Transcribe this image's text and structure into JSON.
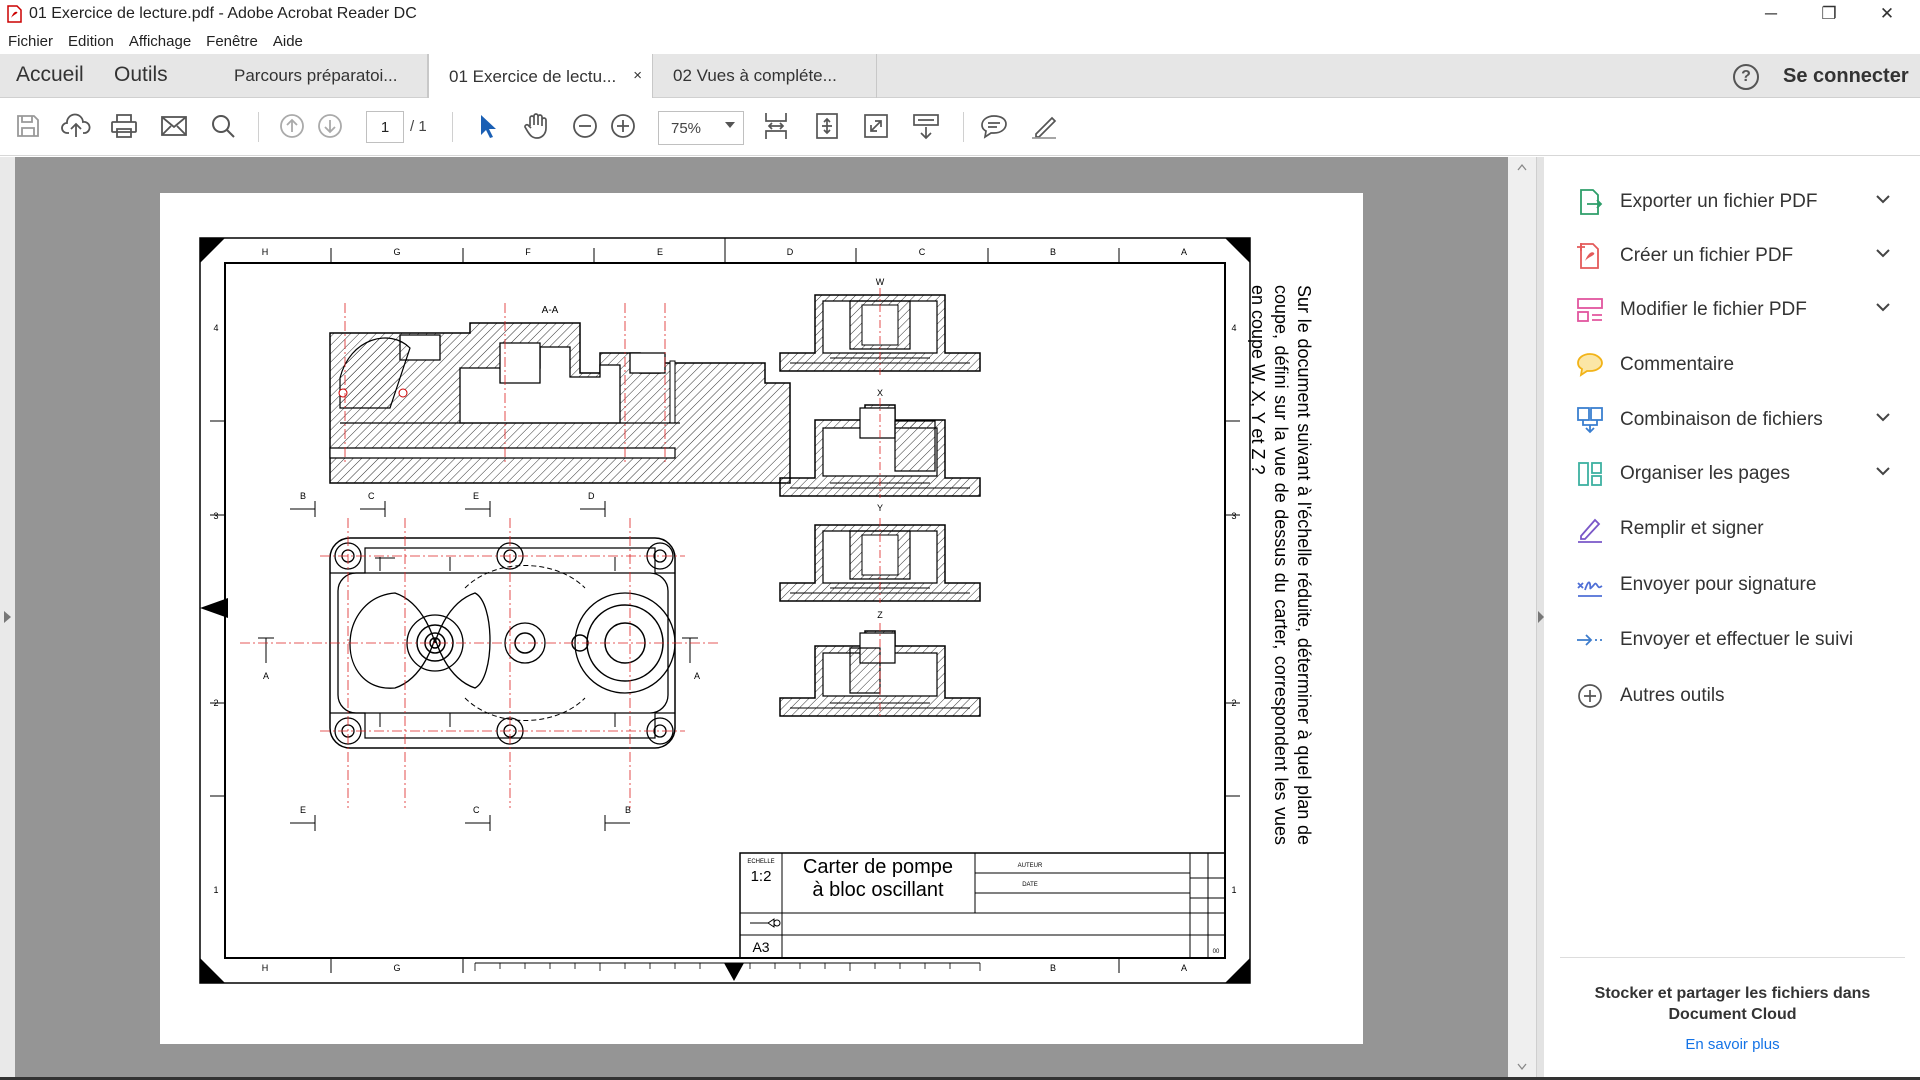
{
  "window": {
    "title": "01 Exercice de lecture.pdf - Adobe Acrobat Reader DC",
    "minimize": "─",
    "maximize": "❐",
    "close": "✕"
  },
  "menu": [
    "Fichier",
    "Edition",
    "Affichage",
    "Fenêtre",
    "Aide"
  ],
  "tabs": {
    "home": "Accueil",
    "tools": "Outils",
    "documents": [
      "Parcours préparatoi...",
      "01 Exercice de lectu...",
      "02 Vues à compléte..."
    ],
    "close": "×"
  },
  "header": {
    "help": "?",
    "signin": "Se connecter"
  },
  "toolbar": {
    "page_current": "1",
    "page_total": "/ 1",
    "zoom": "75%"
  },
  "drawing": {
    "section_label": "A-A",
    "view_labels": [
      "W",
      "X",
      "Y",
      "Z"
    ],
    "zone_letters": [
      "H",
      "G",
      "F",
      "E",
      "D",
      "C",
      "B",
      "A"
    ],
    "zone_numbers": [
      "4",
      "3",
      "2",
      "1"
    ],
    "cut_labels": {
      "top": [
        "B",
        "C",
        "E",
        "D"
      ],
      "bottom": [
        "E",
        "C",
        "B"
      ],
      "side": "A"
    },
    "question": "Sur le document suivant à l'échelle réduite, déterminer à quel plan de coupe, défini sur la vue de dessus du carter, correspondent les vues en coupe W, X, Y et Z ?",
    "title_block": {
      "scale_label": "ECHELLE",
      "scale": "1:2",
      "title_line1": "Carter de pompe",
      "title_line2": "à bloc oscillant",
      "author_label": "AUTEUR",
      "date_label": "DATE",
      "format": "A3",
      "sheet": "00"
    }
  },
  "panel": {
    "tools": [
      {
        "label": "Exporter un fichier PDF",
        "icon": "export-pdf-icon",
        "color": "#2e9e6a",
        "expandable": true
      },
      {
        "label": "Créer un fichier PDF",
        "icon": "create-pdf-icon",
        "color": "#e45a5a",
        "expandable": true
      },
      {
        "label": "Modifier le fichier PDF",
        "icon": "edit-pdf-icon",
        "color": "#e2569f",
        "expandable": true
      },
      {
        "label": "Commentaire",
        "icon": "comment-icon",
        "color": "#f2b318",
        "expandable": false
      },
      {
        "label": "Combinaison de fichiers",
        "icon": "combine-files-icon",
        "color": "#3b7fd0",
        "expandable": true
      },
      {
        "label": "Organiser les pages",
        "icon": "organize-pages-icon",
        "color": "#3cb1a0",
        "expandable": true
      },
      {
        "label": "Remplir et signer",
        "icon": "fill-sign-icon",
        "color": "#7a57c8",
        "expandable": false
      },
      {
        "label": "Envoyer pour signature",
        "icon": "send-signature-icon",
        "color": "#4f6fd6",
        "expandable": false
      },
      {
        "label": "Envoyer et effectuer le suivi",
        "icon": "send-track-icon",
        "color": "#3d7ccc",
        "expandable": false
      },
      {
        "label": "Autres outils",
        "icon": "more-tools-icon",
        "color": "#555555",
        "expandable": false
      }
    ],
    "cloud_text": "Stocker et partager les fichiers dans Document Cloud",
    "cloud_link": "En savoir plus"
  }
}
